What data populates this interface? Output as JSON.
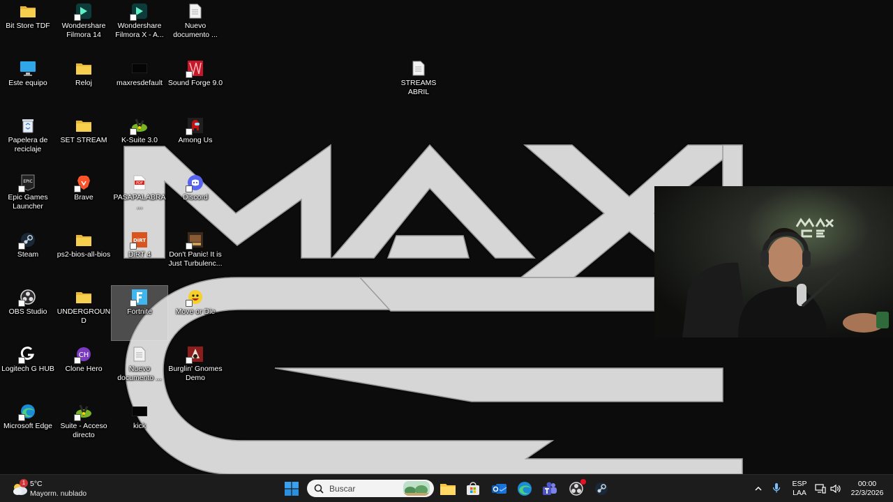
{
  "desktop_icons": [
    {
      "label": "Bit Store TDF",
      "icon": "folder-icon"
    },
    {
      "label": "Wondershare Filmora 14",
      "icon": "filmora-icon"
    },
    {
      "label": "Wondershare Filmora X - A...",
      "icon": "filmora-icon"
    },
    {
      "label": "Nuevo documento ...",
      "icon": "text-document-icon"
    },
    {
      "label": "Este equipo",
      "icon": "computer-icon"
    },
    {
      "label": "Reloj",
      "icon": "folder-icon"
    },
    {
      "label": "maxresdefault",
      "icon": "image-file-icon"
    },
    {
      "label": "Sound Forge 9.0",
      "icon": "sound-forge-icon"
    },
    {
      "label": "STREAMS ABRIL",
      "icon": "text-document-icon"
    },
    {
      "label": "Papelera de reciclaje",
      "icon": "recycle-bin-icon"
    },
    {
      "label": "SET STREAM",
      "icon": "folder-icon"
    },
    {
      "label": "K-Suite 3.0",
      "icon": "k-suite-icon"
    },
    {
      "label": "Among Us",
      "icon": "among-us-icon"
    },
    {
      "label": "Epic Games Launcher",
      "icon": "epic-games-icon"
    },
    {
      "label": "Brave",
      "icon": "brave-icon"
    },
    {
      "label": "PASAPALABRA ...",
      "icon": "pdf-icon"
    },
    {
      "label": "Discord",
      "icon": "discord-icon"
    },
    {
      "label": "Steam",
      "icon": "steam-icon"
    },
    {
      "label": "ps2-bios-all-bios",
      "icon": "folder-icon"
    },
    {
      "label": "DiRT 4",
      "icon": "dirt4-icon"
    },
    {
      "label": "Don't Panic! It is Just Turbulenc...",
      "icon": "game-icon"
    },
    {
      "label": "OBS Studio",
      "icon": "obs-icon"
    },
    {
      "label": "UNDERGROUND",
      "icon": "folder-icon"
    },
    {
      "label": "Fortnite",
      "icon": "fortnite-icon"
    },
    {
      "label": "Move or Die",
      "icon": "move-or-die-icon"
    },
    {
      "label": "Logitech G HUB",
      "icon": "logitech-icon"
    },
    {
      "label": "Clone Hero",
      "icon": "clone-hero-icon"
    },
    {
      "label": "Nuevo documento ...",
      "icon": "text-document-icon"
    },
    {
      "label": "Burglin' Gnomes Demo",
      "icon": "burglin-gnomes-icon"
    },
    {
      "label": "Microsoft Edge",
      "icon": "edge-icon"
    },
    {
      "label": "Suite - Acceso directo",
      "icon": "k-suite-icon"
    },
    {
      "label": "kick",
      "icon": "image-file-icon"
    }
  ],
  "weather": {
    "temp": "5°C",
    "condition": "Mayorm. nublado",
    "badge": "1"
  },
  "search": {
    "placeholder": "Buscar"
  },
  "tray": {
    "lang": "ESP",
    "layout": "LAA",
    "time": "00:00",
    "date": "22/3/2026"
  },
  "taskbar_apps": [
    "windows-start-icon",
    "file-explorer-icon",
    "microsoft-store-icon",
    "outlook-icon",
    "edge-icon",
    "teams-icon",
    "obs-icon",
    "steam-icon"
  ],
  "colors": {
    "taskbar": "#1c1c1c",
    "wallpaper_bg": "#0c0c0c",
    "logo": "#d8d8d8",
    "folder": "#f4c542"
  }
}
